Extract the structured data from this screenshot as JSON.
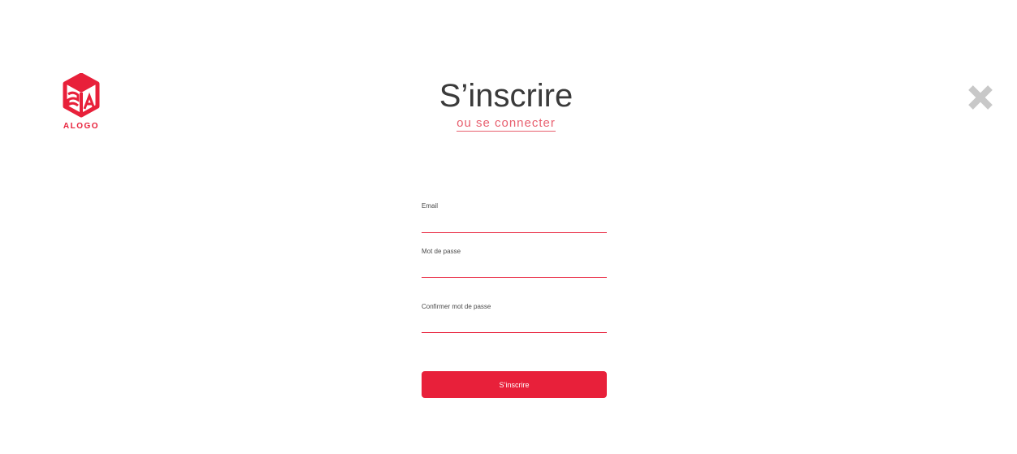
{
  "brand": {
    "name": "ALOGO",
    "accent_color": "#e8203a"
  },
  "header": {
    "title": "S’inscrire",
    "login_link": "ou se connecter",
    "close_icon": "close-icon"
  },
  "form": {
    "email": {
      "label": "Email",
      "value": "",
      "placeholder": ""
    },
    "password": {
      "label": "Mot de passe",
      "value": "",
      "placeholder": ""
    },
    "confirm_password": {
      "label": "Confirmer mot de passe",
      "value": "",
      "placeholder": ""
    },
    "submit_label": "S’inscrire"
  }
}
